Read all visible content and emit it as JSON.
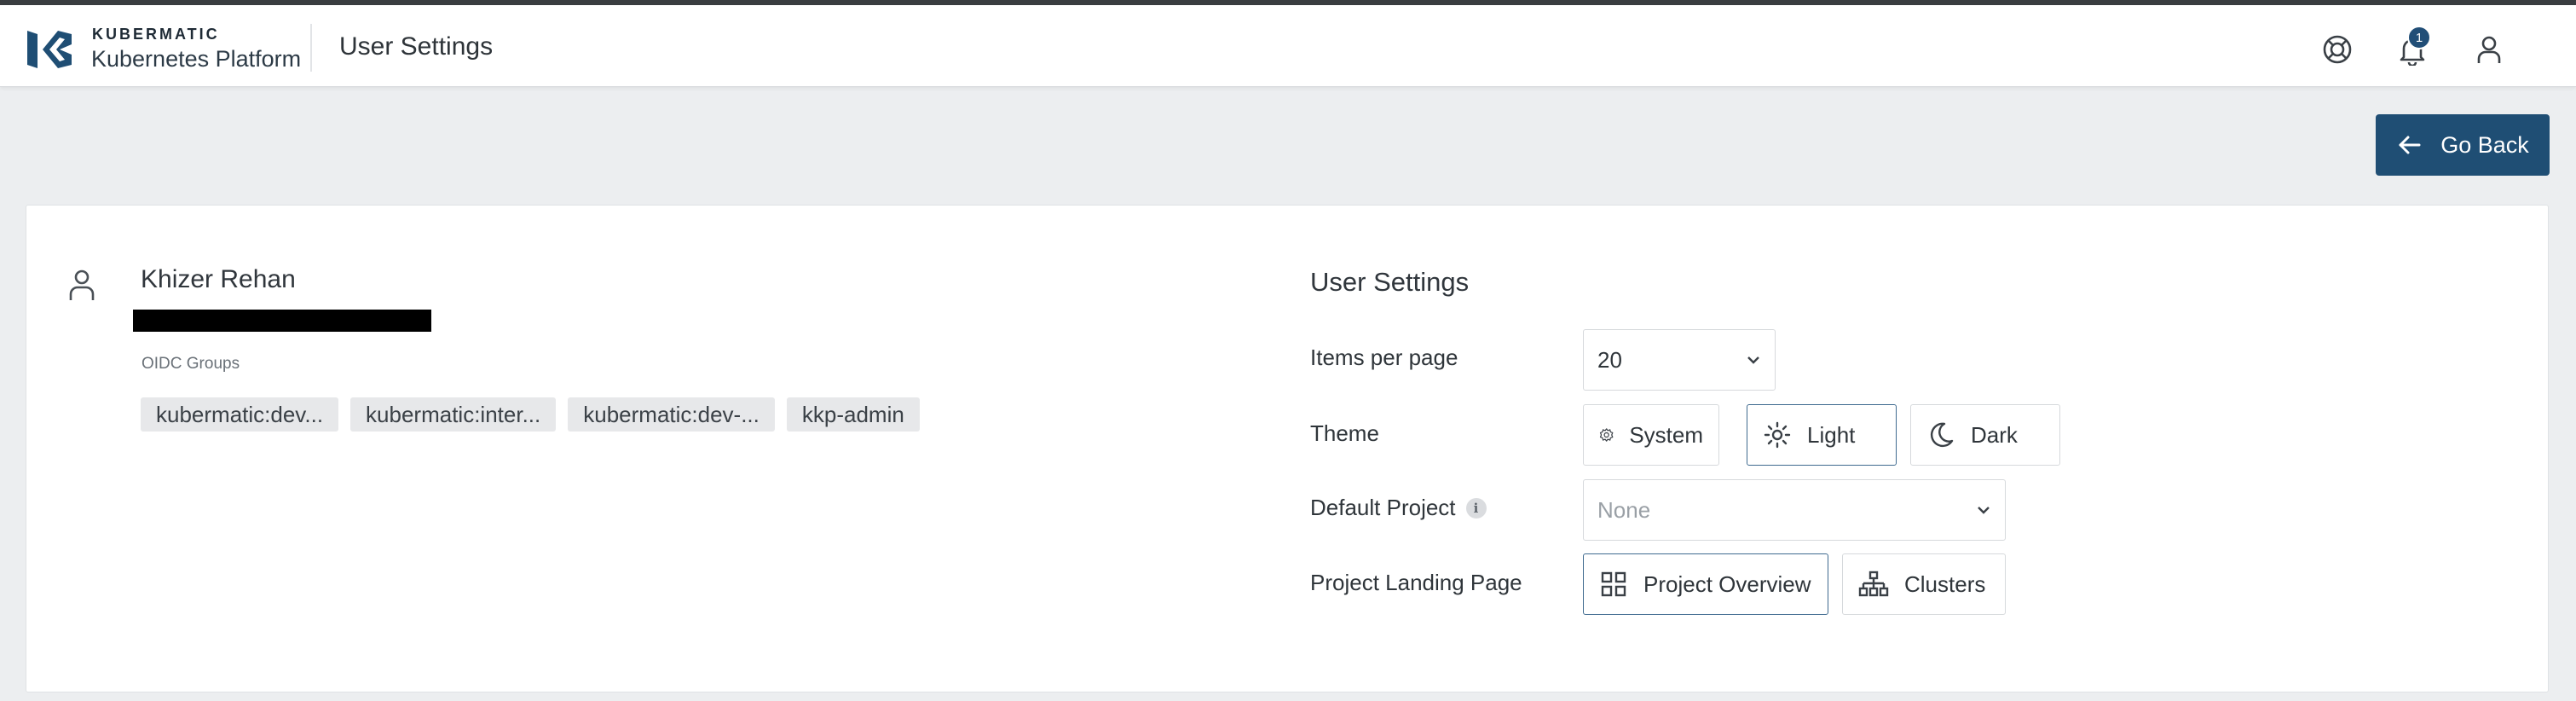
{
  "header": {
    "brand_top": "KUBERMATIC",
    "brand_sub": "Kubernetes Platform",
    "page_title": "User Settings",
    "icons": [
      "help-icon",
      "notifications-icon",
      "account-icon"
    ],
    "notification_count": "1",
    "brand_color": "#1f4e74"
  },
  "go_back": {
    "label": "Go Back"
  },
  "profile": {
    "name": "Khizer Rehan",
    "oidc_label": "OIDC Groups",
    "groups": [
      "kubermatic:dev...",
      "kubermatic:inter...",
      "kubermatic:dev-...",
      "kkp-admin"
    ]
  },
  "settings": {
    "title": "User Settings",
    "items_per_page": {
      "label": "Items per page",
      "value": "20"
    },
    "theme": {
      "label": "Theme",
      "options": [
        {
          "label": "System",
          "icon": "gear-icon",
          "selected": false
        },
        {
          "label": "Light",
          "icon": "sun-icon",
          "selected": true
        },
        {
          "label": "Dark",
          "icon": "moon-icon",
          "selected": false
        }
      ]
    },
    "default_project": {
      "label": "Default Project",
      "placeholder": "None"
    },
    "landing_page": {
      "label": "Project Landing Page",
      "options": [
        {
          "label": "Project Overview",
          "icon": "grid-icon",
          "selected": true
        },
        {
          "label": "Clusters",
          "icon": "hierarchy-icon",
          "selected": false
        }
      ]
    }
  }
}
